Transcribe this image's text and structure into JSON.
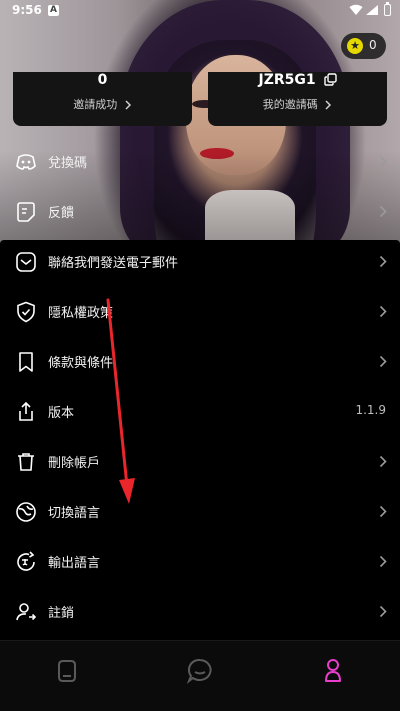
{
  "status_bar": {
    "time": "9:56"
  },
  "coins": {
    "count": "0"
  },
  "stats": {
    "invites_value": "0",
    "invites_label": "邀請成功",
    "code_value": "JZR5G1",
    "code_label": "我的邀請碼"
  },
  "menu": [
    {
      "label": "兌換碼",
      "icon": "discord-icon"
    },
    {
      "label": "反饋",
      "icon": "note-icon"
    },
    {
      "label": "聯絡我們發送電子郵件",
      "icon": "mail-icon"
    },
    {
      "label": "隱私權政策",
      "icon": "shield-check-icon"
    },
    {
      "label": "條款與條件",
      "icon": "bookmark-icon"
    },
    {
      "label": "版本",
      "icon": "share-icon",
      "value": "1.1.9"
    },
    {
      "label": "刪除帳戶",
      "icon": "trash-icon"
    },
    {
      "label": "切換語言",
      "icon": "translate-icon"
    },
    {
      "label": "輸出語言",
      "icon": "translate-output-icon"
    },
    {
      "label": "註銷",
      "icon": "logout-icon"
    }
  ],
  "tabs": [
    {
      "name": "home-icon",
      "active": false
    },
    {
      "name": "chat-icon",
      "active": false
    },
    {
      "name": "profile-icon",
      "active": true
    }
  ],
  "colors": {
    "accent": "#e83ecb",
    "background": "#000000",
    "annotation_arrow": "#e8262b"
  }
}
